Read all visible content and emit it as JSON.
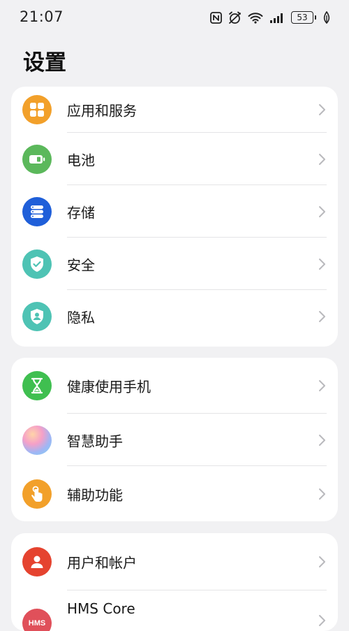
{
  "status_bar": {
    "time": "21:07",
    "battery": "53",
    "icons": [
      "nfc-icon",
      "alarm-off-icon",
      "wifi-icon",
      "cellular-signal-icon",
      "battery-icon",
      "eco-leaf-icon"
    ]
  },
  "page": {
    "title": "设置"
  },
  "groups": [
    {
      "items": [
        {
          "label": "应用和服务",
          "icon": "apps-grid-icon",
          "color": "#f2a02a"
        },
        {
          "label": "电池",
          "icon": "battery-icon",
          "color": "#5bb85b"
        },
        {
          "label": "存储",
          "icon": "storage-icon",
          "color": "#1f5fd9"
        },
        {
          "label": "安全",
          "icon": "shield-check-icon",
          "color": "#4ec3b4"
        },
        {
          "label": "隐私",
          "icon": "privacy-shield-icon",
          "color": "#4ec3b4"
        }
      ]
    },
    {
      "items": [
        {
          "label": "健康使用手机",
          "icon": "hourglass-icon",
          "color": "#3fbf50"
        },
        {
          "label": "智慧助手",
          "icon": "assistant-orb-icon",
          "color": "#b89cf0"
        },
        {
          "label": "辅助功能",
          "icon": "hand-tap-icon",
          "color": "#f2a02a"
        }
      ]
    },
    {
      "items": [
        {
          "label": "用户和帐户",
          "icon": "user-icon",
          "color": "#e5432f"
        },
        {
          "label": "HMS Core",
          "icon": "hms-icon",
          "color": "#e0505a",
          "icon_text": "HMS"
        }
      ]
    }
  ]
}
